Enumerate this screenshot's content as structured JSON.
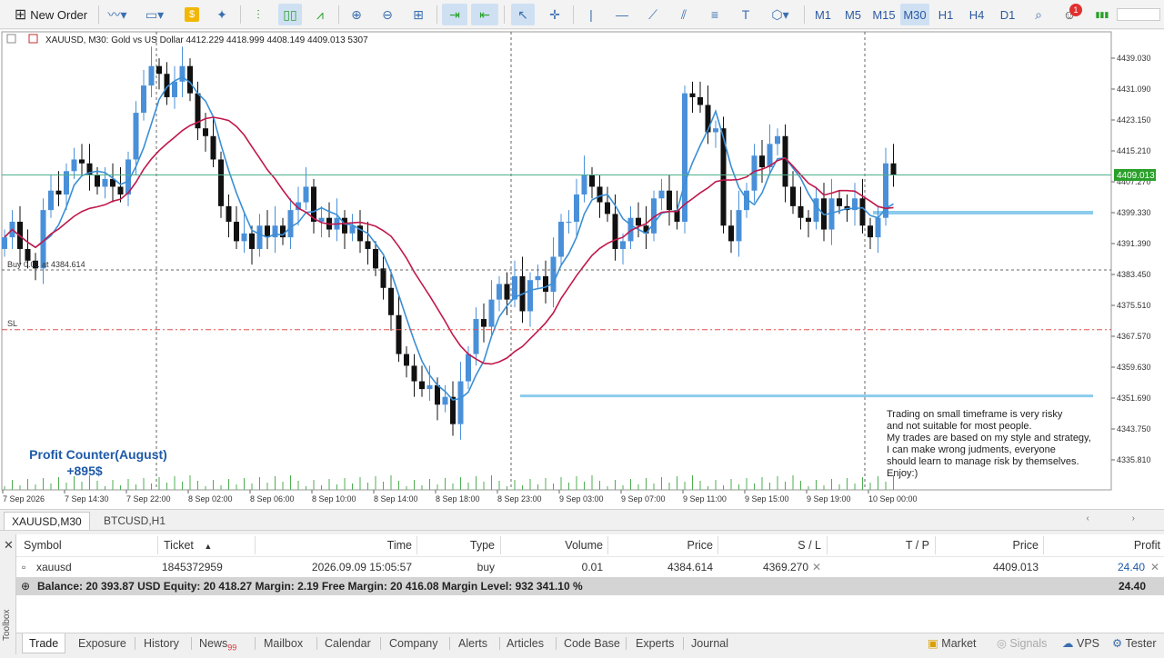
{
  "toolbar": {
    "new_order_label": "New Order",
    "timeframes": [
      "M1",
      "M5",
      "M15",
      "M30",
      "H1",
      "H4",
      "D1"
    ],
    "active_timeframe": "M30",
    "notification_count": "1"
  },
  "chart": {
    "header": "XAUUSD, M30:  Gold vs US Dollar  4412.229 4418.999 4408.149 4409.013  5307",
    "price_ticks": [
      "4439.030",
      "4431.090",
      "4423.150",
      "4415.210",
      "4407.270",
      "4399.330",
      "4391.390",
      "4383.450",
      "4375.510",
      "4367.570",
      "4359.630",
      "4351.690",
      "4343.750",
      "4335.810"
    ],
    "current_price_label": "4409.013",
    "time_ticks": [
      "7 Sep 2026",
      "7 Sep 14:30",
      "7 Sep 22:00",
      "8 Sep 02:00",
      "8 Sep 06:00",
      "8 Sep 10:00",
      "8 Sep 14:00",
      "8 Sep 18:00",
      "8 Sep 23:00",
      "9 Sep 03:00",
      "9 Sep 07:00",
      "9 Sep 11:00",
      "9 Sep 15:00",
      "9 Sep 19:00",
      "10 Sep 00:00"
    ],
    "buy_line_label": "Buy 0.01 at 4384.614",
    "sl_label": "SL",
    "profit_title": "Profit Counter(August)",
    "profit_value": "+895$",
    "disclaimer": [
      "Trading on small timeframe is very risky",
      "and not suitable for most people.",
      "My trades are based on my style and strategy,",
      "I can make wrong judments, everyone",
      "should learn to manage risk by themselves.",
      "Enjoy:)"
    ],
    "colors": {
      "bull": "#4a90d9",
      "bear": "#111111",
      "fast_ma": "#3a8fd6",
      "slow_ma": "#c0184a",
      "zone": "#8ccbec"
    }
  },
  "chart_tabs": [
    "XAUUSD,M30",
    "BTCUSD,H1"
  ],
  "trade": {
    "headers": [
      "Symbol",
      "Ticket",
      "Time",
      "Type",
      "Volume",
      "Price",
      "S / L",
      "T / P",
      "Price",
      "Profit"
    ],
    "row": {
      "symbol": "xauusd",
      "ticket": "1845372959",
      "time": "2026.09.09 15:05:57",
      "type": "buy",
      "volume": "0.01",
      "price": "4384.614",
      "sl": "4369.270",
      "tp": "",
      "current": "4409.013",
      "profit": "24.40"
    },
    "balance_text": "Balance: 20 393.87 USD  Equity: 20 418.27  Margin: 2.19  Free Margin: 20 416.08  Margin Level: 932 341.10 %",
    "balance_profit": "24.40"
  },
  "toolbox_label": "Toolbox",
  "bottom_tabs": [
    "Trade",
    "Exposure",
    "History",
    "News",
    "Mailbox",
    "Calendar",
    "Company",
    "Alerts",
    "Articles",
    "Code Base",
    "Experts",
    "Journal"
  ],
  "news_badge": "99",
  "right_tabs": [
    "Market",
    "Signals",
    "VPS",
    "Tester"
  ]
}
